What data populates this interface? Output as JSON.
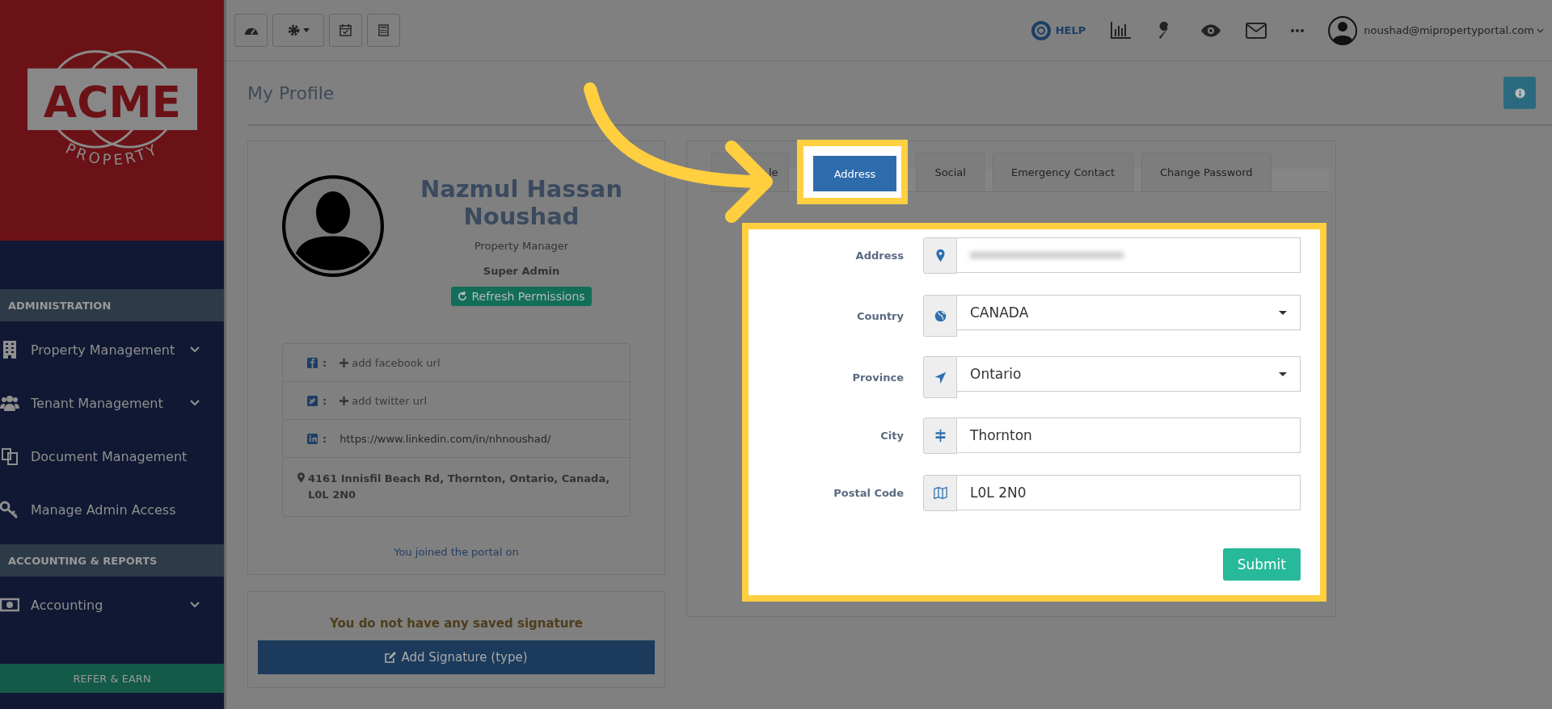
{
  "sidebar": {
    "logo": {
      "name": "ACME",
      "tagline": "PROPERTY"
    },
    "entries": [
      {
        "kind": "section",
        "label": "ADMINISTRATION"
      },
      {
        "kind": "item",
        "label": "Property Management",
        "expandable": true
      },
      {
        "kind": "item",
        "label": "Tenant Management",
        "expandable": true
      },
      {
        "kind": "item",
        "label": "Document Management",
        "expandable": false
      },
      {
        "kind": "item",
        "label": "Manage Admin Access",
        "expandable": false
      },
      {
        "kind": "section",
        "label": "ACCOUNTING & REPORTS"
      },
      {
        "kind": "item",
        "label": "Accounting",
        "expandable": true
      }
    ],
    "refer_button": "REFER & EARN"
  },
  "toolbar": {
    "help": "HELP",
    "user_email": "noushad@mipropertyportal.com"
  },
  "page_title": "My Profile",
  "profile": {
    "name": "Nazmul Hassan Noushad",
    "role": "Property Manager",
    "access": "Super Admin",
    "refresh_button": "Refresh Permissions",
    "social": [
      {
        "kind": "facebook",
        "separator": ":",
        "text": "add facebook url",
        "added": false
      },
      {
        "kind": "twitter",
        "separator": ":",
        "text": "add twitter url",
        "added": false
      },
      {
        "kind": "linkedin",
        "separator": ":",
        "text": "https://www.linkedin.com/in/nhnoushad/",
        "added": true
      }
    ],
    "address": "4161 Innisfil Beach Rd, Thornton, Ontario, Canada, L0L 2N0",
    "joined": "You joined the portal on"
  },
  "signature": {
    "message": "You do not have any saved signature",
    "button": "Add Signature (type)"
  },
  "tabs": [
    {
      "label": "le",
      "selected": false
    },
    {
      "label": "Address",
      "selected": true
    },
    {
      "label": "Social",
      "selected": false
    },
    {
      "label": "Emergency Contact",
      "selected": false
    },
    {
      "label": "Change Password",
      "selected": false
    }
  ],
  "form": {
    "fields": [
      {
        "label": "Address",
        "kind": "redacted"
      },
      {
        "label": "Country",
        "kind": "select",
        "value": "CANADA"
      },
      {
        "label": "Province",
        "kind": "select",
        "value": "Ontario"
      },
      {
        "label": "City",
        "kind": "text",
        "value": "Thornton"
      },
      {
        "label": "Postal Code",
        "kind": "text",
        "value": "L0L 2N0"
      }
    ],
    "submit": "Submit"
  }
}
